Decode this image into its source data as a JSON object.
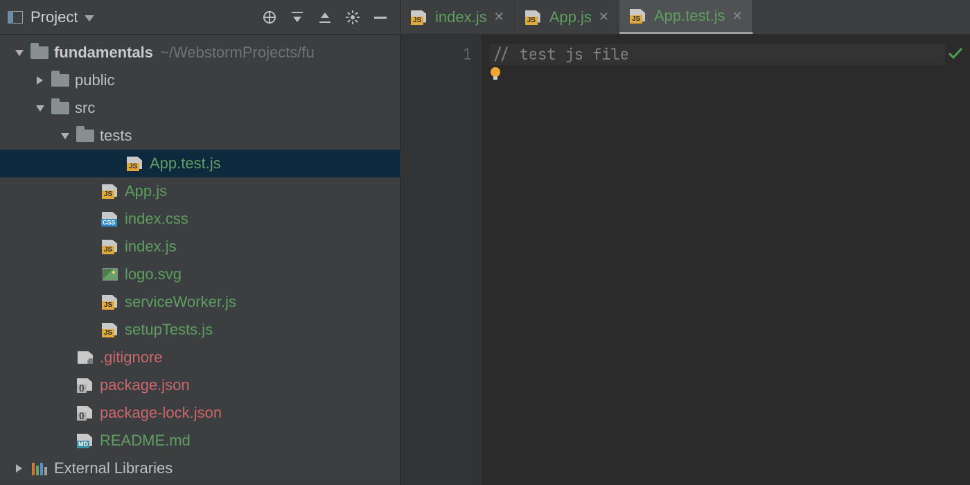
{
  "panel": {
    "title": "Project"
  },
  "tree": {
    "root": {
      "name": "fundamentals",
      "path_hint": "~/WebstormProjects/fu"
    },
    "nodes": [
      {
        "label": "public",
        "kind": "folder",
        "indent": "indent-1",
        "arrow": "right",
        "color": ""
      },
      {
        "label": "src",
        "kind": "folder",
        "indent": "indent-1",
        "arrow": "down",
        "color": ""
      },
      {
        "label": "tests",
        "kind": "folder",
        "indent": "indent-2",
        "arrow": "down",
        "color": ""
      },
      {
        "label": "App.test.js",
        "kind": "js",
        "indent": "indent-s",
        "arrow": "none",
        "color": "green",
        "selected": true
      },
      {
        "label": "App.js",
        "kind": "js",
        "indent": "indent-src",
        "arrow": "none",
        "color": "green"
      },
      {
        "label": "index.css",
        "kind": "css",
        "indent": "indent-src",
        "arrow": "none",
        "color": "green"
      },
      {
        "label": "index.js",
        "kind": "js",
        "indent": "indent-src",
        "arrow": "none",
        "color": "green"
      },
      {
        "label": "logo.svg",
        "kind": "img",
        "indent": "indent-src",
        "arrow": "none",
        "color": "green"
      },
      {
        "label": "serviceWorker.js",
        "kind": "js",
        "indent": "indent-src",
        "arrow": "none",
        "color": "green"
      },
      {
        "label": "setupTests.js",
        "kind": "js",
        "indent": "indent-src",
        "arrow": "none",
        "color": "green"
      },
      {
        "label": ".gitignore",
        "kind": "plain",
        "indent": "indent-root",
        "arrow": "none",
        "color": "red"
      },
      {
        "label": "package.json",
        "kind": "json",
        "indent": "indent-root",
        "arrow": "none",
        "color": "red"
      },
      {
        "label": "package-lock.json",
        "kind": "json",
        "indent": "indent-root",
        "arrow": "none",
        "color": "red"
      },
      {
        "label": "README.md",
        "kind": "md",
        "indent": "indent-root",
        "arrow": "none",
        "color": "green"
      }
    ],
    "external_libs": "External Libraries"
  },
  "tabs": [
    {
      "label": "index.js",
      "active": false
    },
    {
      "label": "App.js",
      "active": false
    },
    {
      "label": "App.test.js",
      "active": true
    }
  ],
  "editor": {
    "line_number": "1",
    "line1": "// test js file"
  }
}
